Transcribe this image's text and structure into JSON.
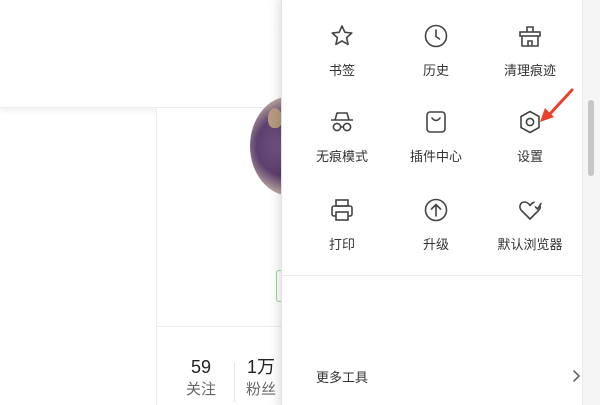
{
  "menu": {
    "items": [
      {
        "label": "书签",
        "icon": "star-icon"
      },
      {
        "label": "历史",
        "icon": "clock-icon"
      },
      {
        "label": "清理痕迹",
        "icon": "broom-clean-icon"
      },
      {
        "label": "无痕模式",
        "icon": "incognito-icon"
      },
      {
        "label": "插件中心",
        "icon": "bag-plugin-icon"
      },
      {
        "label": "设置",
        "icon": "hexagon-settings-icon"
      },
      {
        "label": "打印",
        "icon": "printer-icon"
      },
      {
        "label": "升级",
        "icon": "upgrade-arrow-icon"
      },
      {
        "label": "默认浏览器",
        "icon": "heart-icon"
      }
    ],
    "more_tools_label": "更多工具"
  },
  "profile": {
    "stats": [
      {
        "value": "59",
        "label": "关注"
      },
      {
        "value": "1万",
        "label": "粉丝"
      }
    ]
  },
  "annotation": {
    "color": "#e8412c",
    "points_to": "设置"
  }
}
